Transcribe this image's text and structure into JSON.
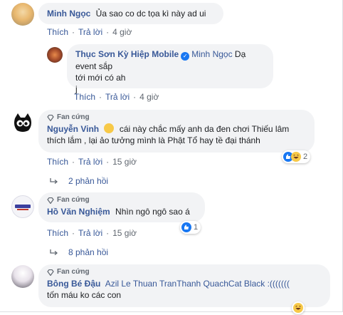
{
  "comments": [
    {
      "author": "Minh Ngọc",
      "text": "Ủa sao co dc tọa kì này ad ui",
      "like": "Thích",
      "reply": "Trả lời",
      "time": "4 giờ"
    },
    {
      "author": "Thục Sơn Kỳ Hiệp Mobile",
      "mention": "Minh Ngọc",
      "text_line1": "Dạ event sắp",
      "text_line2": "tới mới có ah",
      "text_line3": "j",
      "like": "Thích",
      "reply": "Trả lời",
      "time": "4 giờ"
    },
    {
      "badge": "Fan cứng",
      "author": "Nguyễn Vinh",
      "text_line1": "cái này chắc mấy anh da đen chơi Thiếu lâm",
      "text_line2": "thích lắm , lại ảo tưởng mình là Phật Tổ hay tề đại thánh",
      "reaction_count": "2",
      "like": "Thích",
      "reply": "Trả lời",
      "time": "15 giờ",
      "replies": "2 phản hồi"
    },
    {
      "badge": "Fan cứng",
      "author": "Hồ Văn Nghiệm",
      "text": "Nhìn ngô ngô sao á",
      "reaction_count": "1",
      "like": "Thích",
      "reply": "Trả lời",
      "time": "15 giờ",
      "replies": "8 phản hồi"
    },
    {
      "badge": "Fan cứng",
      "author": "Bông Bé Đậu",
      "text_line1": "Azil Le Thuan TranThanh QuachCat Black :(((((((",
      "text_line2": "tốn máu ko các con"
    }
  ],
  "colors": {
    "link": "#385898",
    "bubble": "#f2f3f5",
    "meta": "#606770",
    "like_blue": "#1877f2",
    "haha_yellow": "#f7c948"
  }
}
